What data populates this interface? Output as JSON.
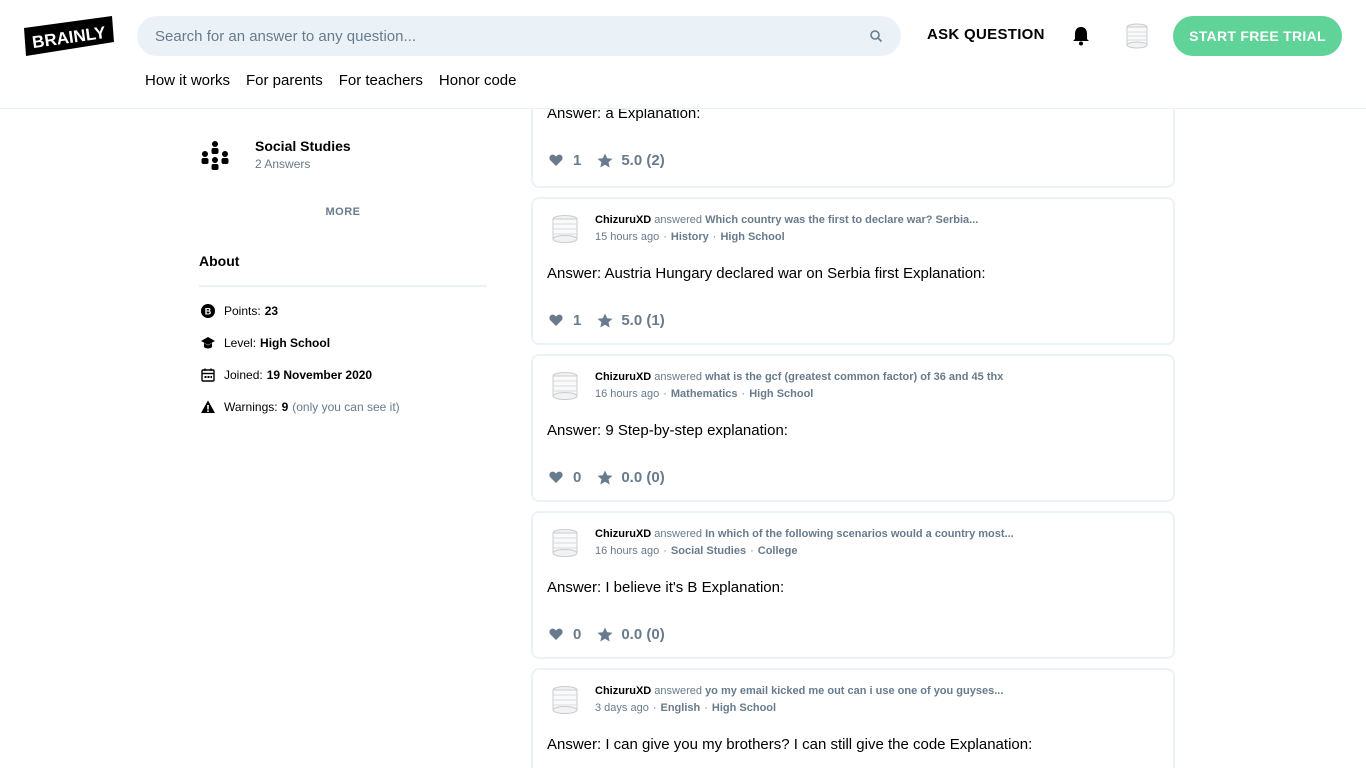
{
  "header": {
    "logo_text": "BRAINLY",
    "search_placeholder": "Search for an answer to any question...",
    "ask_label": "ASK QUESTION",
    "trial_label": "START FREE TRIAL",
    "nav": [
      "How it works",
      "For parents",
      "For teachers",
      "Honor code"
    ]
  },
  "sidebar": {
    "subject": {
      "name": "Social Studies",
      "answers": "2 Answers"
    },
    "more_label": "MORE",
    "about_title": "About",
    "points": {
      "label": "Points:",
      "value": "23"
    },
    "level": {
      "label": "Level:",
      "value": "High School"
    },
    "joined": {
      "label": "Joined:",
      "value": "19 November 2020"
    },
    "warnings": {
      "label": "Warnings:",
      "value": "9",
      "note": "(only you can see it)"
    }
  },
  "feed": {
    "top_card": {
      "answer": "Answer: a Explanation:",
      "likes": "1",
      "rating": "5.0 (2)"
    },
    "cards": [
      {
        "user": "ChizuruXD",
        "verb": "answered",
        "question": "Which country was the first to declare war? Serbia...",
        "time": "15 hours ago",
        "subject": "History",
        "level": "High School",
        "answer": "Answer: Austria Hungary declared war on Serbia first Explanation:",
        "likes": "1",
        "rating": "5.0 (1)"
      },
      {
        "user": "ChizuruXD",
        "verb": "answered",
        "question": "what is the gcf (greatest common factor) of 36 and 45 thx",
        "time": "16 hours ago",
        "subject": "Mathematics",
        "level": "High School",
        "answer": "Answer: 9 Step-by-step explanation:",
        "likes": "0",
        "rating": "0.0 (0)"
      },
      {
        "user": "ChizuruXD",
        "verb": "answered",
        "question": "In which of the following scenarios would a country most...",
        "time": "16 hours ago",
        "subject": "Social Studies",
        "level": "College",
        "answer": "Answer: I believe it's B Explanation:",
        "likes": "0",
        "rating": "0.0 (0)"
      },
      {
        "user": "ChizuruXD",
        "verb": "answered",
        "question": "yo my email kicked me out can i use one of you guyses...",
        "time": "3 days ago",
        "subject": "English",
        "level": "High School",
        "answer": "Answer: I can give you my brothers? I can still give the code Explanation:",
        "likes": "",
        "rating": ""
      }
    ]
  },
  "colors": {
    "accent_green": "#60d399",
    "muted_text": "#687b8c",
    "border": "#ebf2f7"
  }
}
